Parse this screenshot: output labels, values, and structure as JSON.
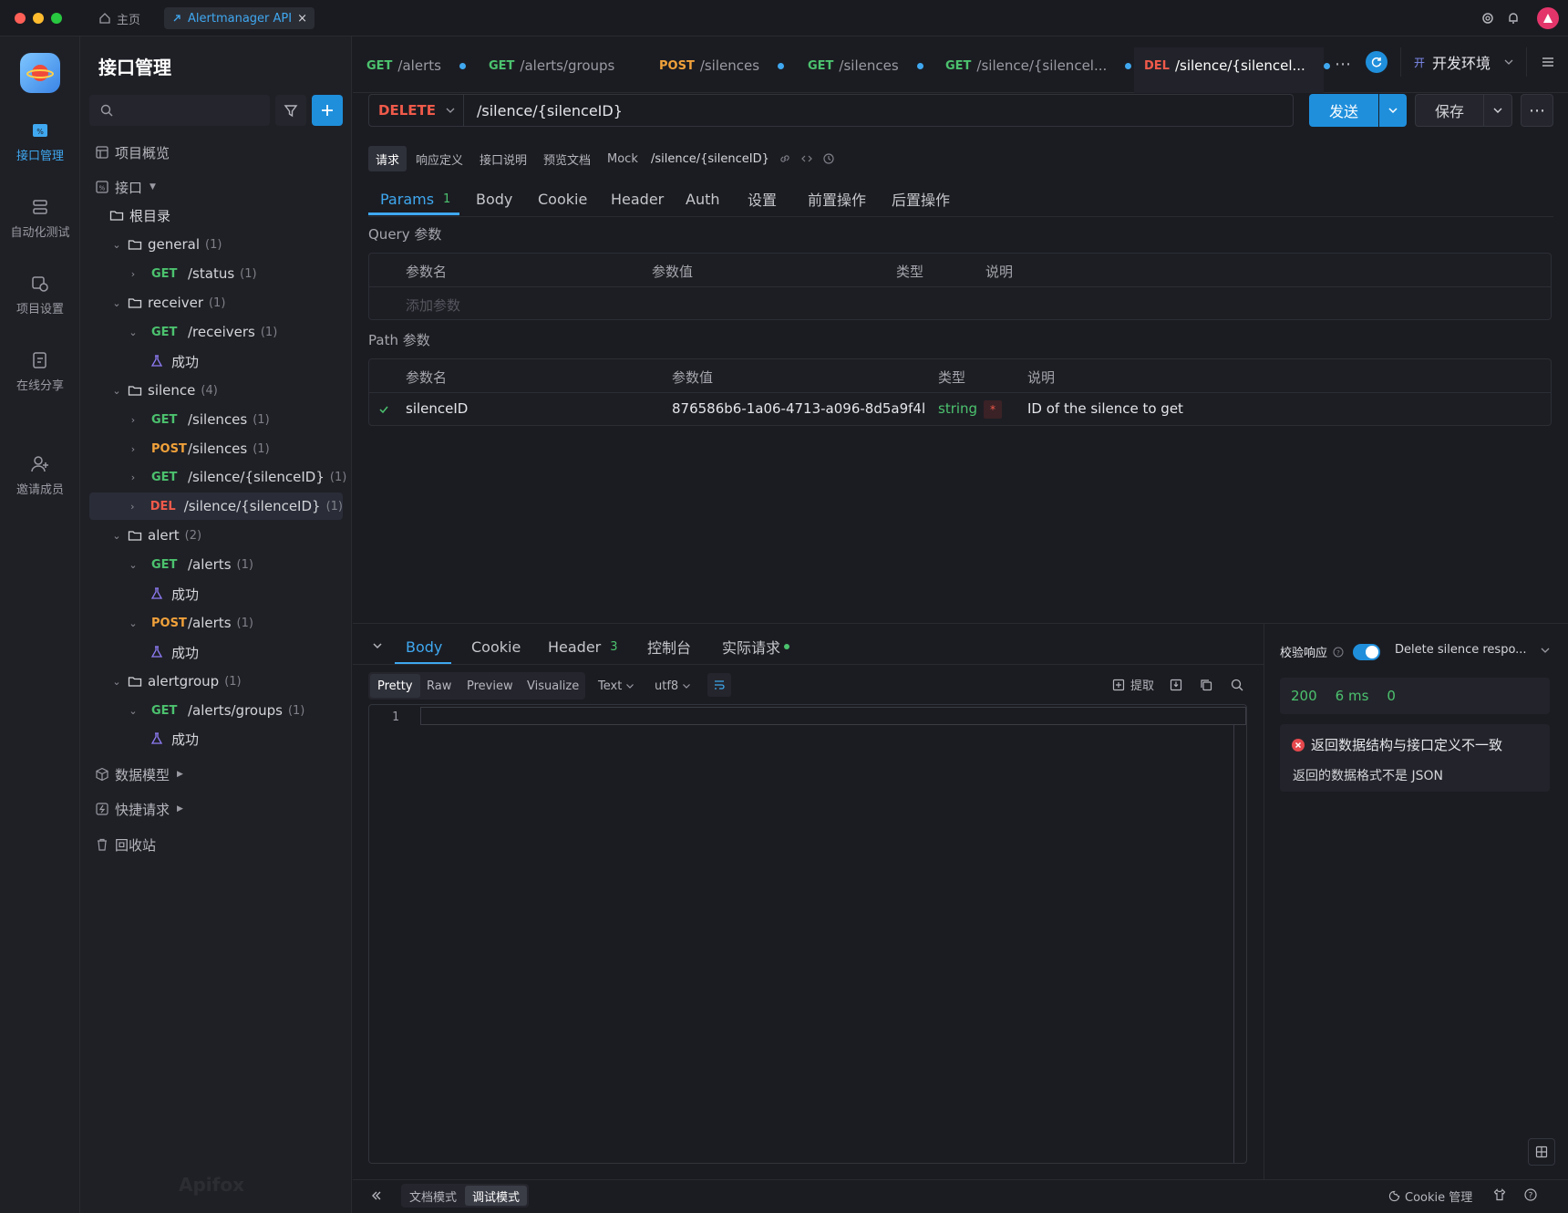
{
  "titlebar": {
    "home_label": "主页",
    "tab_label": "Alertmanager API",
    "tab_close": "×"
  },
  "rail": {
    "items": [
      {
        "label": "接口管理",
        "icon": "api-icon"
      },
      {
        "label": "自动化测试",
        "icon": "automation-icon"
      },
      {
        "label": "项目设置",
        "icon": "settings-icon"
      },
      {
        "label": "在线分享",
        "icon": "share-icon"
      },
      {
        "label": "邀请成员",
        "icon": "invite-icon"
      }
    ]
  },
  "sidebar": {
    "title": "接口管理",
    "search_placeholder": "",
    "overview": "项目概览",
    "interfaces": "接口",
    "root": "根目录",
    "tree": [
      {
        "type": "folder",
        "label": "general",
        "count": "(1)"
      },
      {
        "type": "api",
        "method": "GET",
        "label": "/status",
        "count": "(1)"
      },
      {
        "type": "folder",
        "label": "receiver",
        "count": "(1)"
      },
      {
        "type": "api",
        "method": "GET",
        "label": "/receivers",
        "count": "(1)"
      },
      {
        "type": "case",
        "label": "成功"
      },
      {
        "type": "folder",
        "label": "silence",
        "count": "(4)"
      },
      {
        "type": "api",
        "method": "GET",
        "label": "/silences",
        "count": "(1)"
      },
      {
        "type": "api",
        "method": "POST",
        "label": "/silences",
        "count": "(1)"
      },
      {
        "type": "api",
        "method": "GET",
        "label": "/silence/{silenceID}",
        "count": "(1)"
      },
      {
        "type": "api",
        "method": "DEL",
        "label": "/silence/{silenceID}",
        "count": "(1)"
      },
      {
        "type": "folder",
        "label": "alert",
        "count": "(2)"
      },
      {
        "type": "api",
        "method": "GET",
        "label": "/alerts",
        "count": "(1)"
      },
      {
        "type": "case",
        "label": "成功"
      },
      {
        "type": "api",
        "method": "POST",
        "label": "/alerts",
        "count": "(1)"
      },
      {
        "type": "case",
        "label": "成功"
      },
      {
        "type": "folder",
        "label": "alertgroup",
        "count": "(1)"
      },
      {
        "type": "api",
        "method": "GET",
        "label": "/alerts/groups",
        "count": "(1)"
      },
      {
        "type": "case",
        "label": "成功"
      }
    ],
    "data_models": "数据模型",
    "quick_requests": "快捷请求",
    "trash": "回收站",
    "watermark": "Apifox"
  },
  "tabs": [
    {
      "method": "GET",
      "path": "/alerts"
    },
    {
      "method": "GET",
      "path": "/alerts/groups"
    },
    {
      "method": "POST",
      "path": "/silences"
    },
    {
      "method": "GET",
      "path": "/silences"
    },
    {
      "method": "GET",
      "path": "/silence/{silencel..."
    },
    {
      "method": "DEL",
      "path": "/silence/{silencel..."
    }
  ],
  "env": {
    "badge": "开",
    "label": "开发环境"
  },
  "request": {
    "method": "DELETE",
    "url": "/silence/{silenceID}",
    "send": "发送",
    "save": "保存"
  },
  "subtabs": [
    "请求",
    "响应定义",
    "接口说明",
    "预览文档",
    "Mock"
  ],
  "subpath": "/silence/{silenceID}",
  "param_tabs": [
    "Params",
    "Body",
    "Cookie",
    "Header",
    "Auth",
    "设置",
    "前置操作",
    "后置操作"
  ],
  "params_count": "1",
  "query": {
    "title": "Query 参数",
    "headers": [
      "参数名",
      "参数值",
      "类型",
      "说明"
    ],
    "add_placeholder": "添加参数"
  },
  "path": {
    "title": "Path 参数",
    "headers": [
      "参数名",
      "参数值",
      "类型",
      "说明"
    ],
    "row": {
      "name": "silenceID",
      "value": "876586b6-1a06-4713-a096-8d5a9f4l",
      "type": "string",
      "required": "*",
      "desc": "ID of the silence to get"
    }
  },
  "response": {
    "tabs": [
      "Body",
      "Cookie",
      "Header",
      "控制台",
      "实际请求"
    ],
    "header_count": "3",
    "view_buttons": [
      "Pretty",
      "Raw",
      "Preview",
      "Visualize"
    ],
    "format": "Text",
    "encoding": "utf8",
    "extract": "提取",
    "line_number": "1"
  },
  "validation": {
    "label": "校验响应",
    "schema": "Delete silence respo...",
    "status": "200",
    "time": "6 ms",
    "size": "0",
    "error_title": "返回数据结构与接口定义不一致",
    "error_detail": "返回的数据格式不是 JSON"
  },
  "statusbar": {
    "doc_mode": "文档模式",
    "debug_mode": "调试模式",
    "cookie": "Cookie 管理"
  },
  "colors": {
    "accent": "#3fa8f0",
    "get": "#4cc26e",
    "post": "#f0a13a",
    "del": "#f05a4a"
  }
}
